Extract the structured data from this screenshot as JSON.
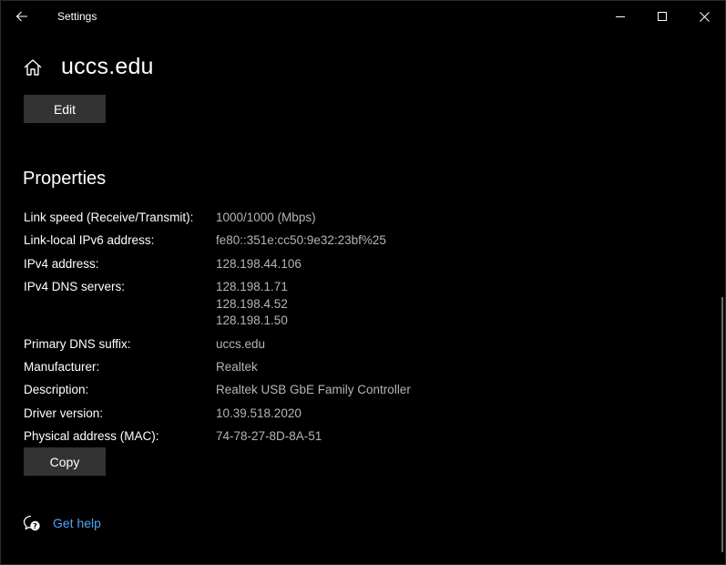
{
  "window": {
    "title": "Settings"
  },
  "header": {
    "title": "uccs.edu",
    "edit_label": "Edit"
  },
  "properties": {
    "section_title": "Properties",
    "rows": [
      {
        "label": "Link speed (Receive/Transmit):",
        "values": [
          "1000/1000 (Mbps)"
        ]
      },
      {
        "label": "Link-local IPv6 address:",
        "values": [
          "fe80::351e:cc50:9e32:23bf%25"
        ]
      },
      {
        "label": "IPv4 address:",
        "values": [
          "128.198.44.106"
        ]
      },
      {
        "label": "IPv4 DNS servers:",
        "values": [
          "128.198.1.71",
          "128.198.4.52",
          "128.198.1.50"
        ]
      },
      {
        "label": "Primary DNS suffix:",
        "values": [
          "uccs.edu"
        ]
      },
      {
        "label": "Manufacturer:",
        "values": [
          "Realtek"
        ]
      },
      {
        "label": "Description:",
        "values": [
          "Realtek USB GbE Family Controller"
        ]
      },
      {
        "label": "Driver version:",
        "values": [
          "10.39.518.2020"
        ]
      },
      {
        "label": "Physical address (MAC):",
        "values": [
          "74-78-27-8D-8A-51"
        ]
      }
    ],
    "copy_label": "Copy"
  },
  "help": {
    "label": "Get help"
  },
  "colors": {
    "background": "#000000",
    "button": "#333333",
    "link": "#4ca5f5",
    "value_text": "#b5b5b5"
  }
}
